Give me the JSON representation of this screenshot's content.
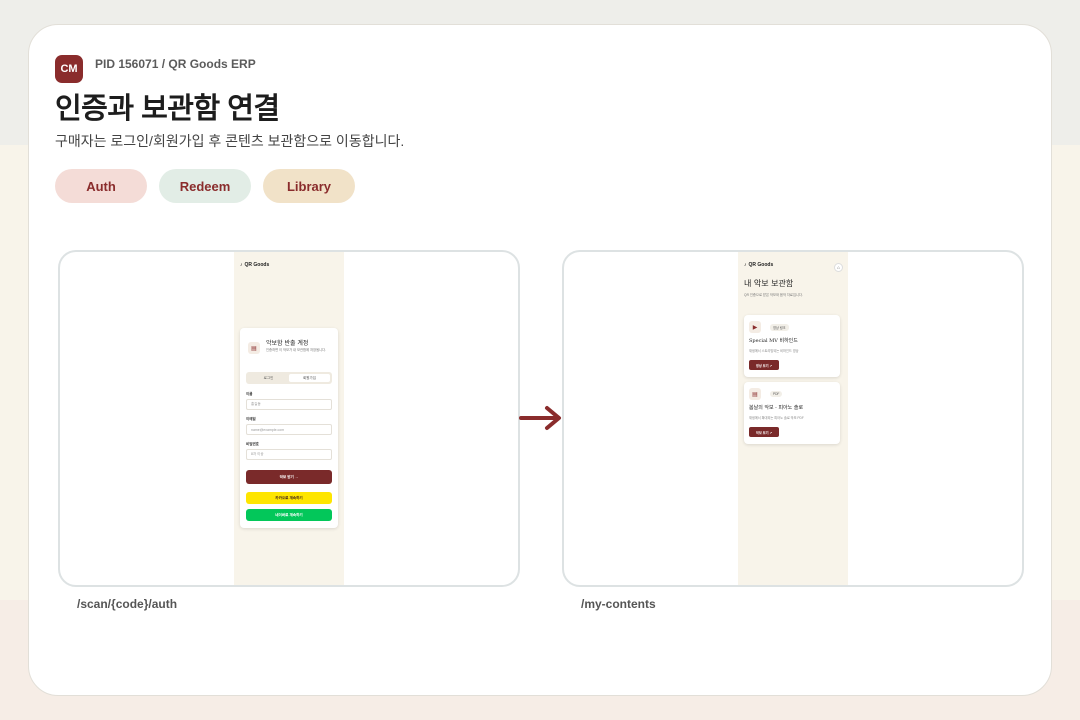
{
  "header": {
    "logo": "CM",
    "pid": "PID 156071 / QR Goods ERP",
    "title": "인증과 보관함 연결",
    "subtitle": "구매자는 로그인/회원가입 후 콘텐츠 보관함으로 이동합니다."
  },
  "tags": [
    {
      "label": "Auth",
      "color": "#f4dcd7"
    },
    {
      "label": "Redeem",
      "color": "#e2ede6"
    },
    {
      "label": "Library",
      "color": "#f1e2c8"
    }
  ],
  "auth_screen": {
    "brand": "QR Goods",
    "card_title": "악보함 반출 계정",
    "card_desc": "인증하면 이 악보가 내 보관함에 저장됩니다.",
    "tabs": [
      "로그인",
      "회원가입"
    ],
    "fields": [
      {
        "label": "이름",
        "placeholder": "홍길동"
      },
      {
        "label": "이메일",
        "placeholder": "name@example.com"
      },
      {
        "label": "비밀번호",
        "placeholder": "8자 이상"
      }
    ],
    "submit": "악보 받기 →",
    "kakao": "카카오로 계속하기",
    "naver": "네이버로 계속하기",
    "path": "/scan/{code}/auth"
  },
  "library_screen": {
    "brand": "QR Goods",
    "title": "내 악보 보관함",
    "desc": "QR 인증으로 받은 악보와 음악 자료입니다.",
    "items": [
      {
        "badge": "영상 링크",
        "title": "Special MV 비하인드",
        "desc": "재생에서 스트리밍되는 비하인드 영상",
        "button": "영상 보기 ↗"
      },
      {
        "badge": "PDF",
        "title": "봄날의 악보 - 피아노 솔로",
        "desc": "재생에서 확대되는 피아노 솔로 악보 PDF",
        "button": "악보 보기 ↗"
      }
    ],
    "path": "/my-contents"
  },
  "colors": {
    "brand": "#8a2c2c",
    "kakao": "#fee500",
    "naver": "#03c75a"
  }
}
